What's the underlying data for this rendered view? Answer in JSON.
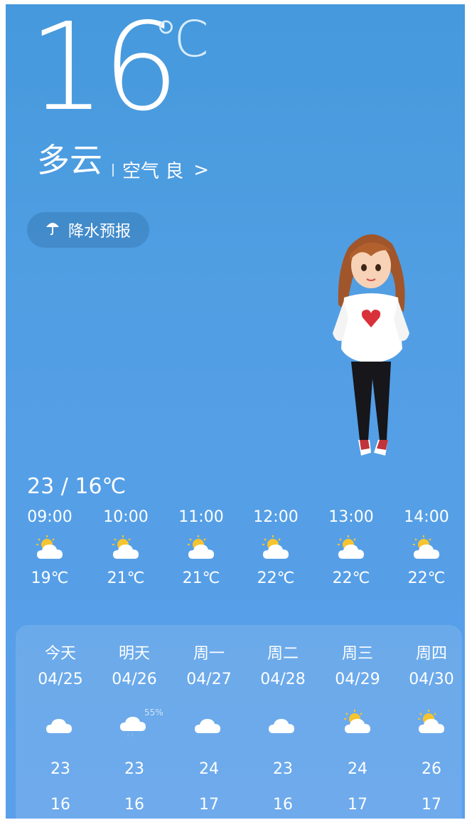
{
  "current": {
    "temperature": "16",
    "unit": "℃",
    "condition": "多云",
    "air_quality": "空气 良",
    "arrow": ">"
  },
  "precip": {
    "label": "降水预报",
    "icon": "umbrella-icon"
  },
  "today_range": "23 / 16℃",
  "hourly": [
    {
      "time": "09:00",
      "icon": "partly-sunny-icon",
      "temp": "19℃"
    },
    {
      "time": "10:00",
      "icon": "partly-sunny-icon",
      "temp": "21℃"
    },
    {
      "time": "11:00",
      "icon": "partly-sunny-icon",
      "temp": "21℃"
    },
    {
      "time": "12:00",
      "icon": "partly-sunny-icon",
      "temp": "22℃"
    },
    {
      "time": "13:00",
      "icon": "partly-sunny-icon",
      "temp": "22℃"
    },
    {
      "time": "14:00",
      "icon": "partly-sunny-icon",
      "temp": "22℃"
    }
  ],
  "daily": [
    {
      "day": "今天",
      "date": "04/25",
      "icon": "cloudy-icon",
      "hi": "23",
      "lo": "16"
    },
    {
      "day": "明天",
      "date": "04/26",
      "icon": "rain-cloud-icon",
      "precip": "55%",
      "hi": "23",
      "lo": "16"
    },
    {
      "day": "周一",
      "date": "04/27",
      "icon": "cloudy-icon",
      "hi": "24",
      "lo": "17"
    },
    {
      "day": "周二",
      "date": "04/28",
      "icon": "cloudy-icon",
      "hi": "23",
      "lo": "16"
    },
    {
      "day": "周三",
      "date": "04/29",
      "icon": "partly-sunny-icon",
      "hi": "24",
      "lo": "17"
    },
    {
      "day": "周四",
      "date": "04/30",
      "icon": "partly-sunny-icon",
      "hi": "26",
      "lo": "17"
    }
  ],
  "colors": {
    "background_top": "#4599dc",
    "background_bottom": "#5a9fea",
    "sun": "#f6c431",
    "cloud": "#ffffff"
  }
}
